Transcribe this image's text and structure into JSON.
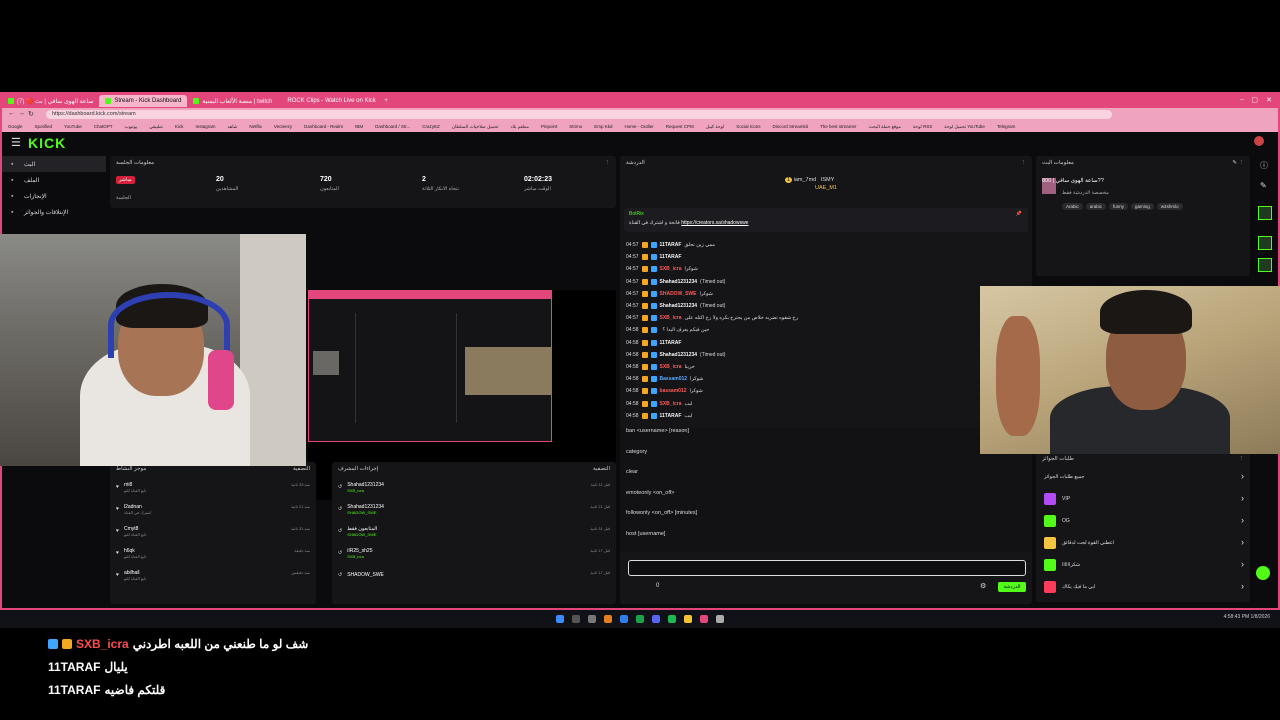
{
  "browser": {
    "tabs": [
      {
        "label": "(7) 🔴 ساعة الهوى ساقي | بث",
        "active": false
      },
      {
        "label": "Stream - Kick Dashboard",
        "active": true
      },
      {
        "label": "منصة الألعاب اليمنية | twitch",
        "active": false
      },
      {
        "label": "ROCK Clips - Watch Live on Kick",
        "active": false
      }
    ],
    "url": "https://dashboard.kick.com/stream",
    "bookmarks": [
      "Google",
      "Spotified",
      "YouTube",
      "ChatGPT",
      "يوتيوب",
      "تطبيقي",
      "Kick",
      "Instagram",
      "شاهد",
      "Netflix",
      "Vecteezy",
      "Dashboard - Realm",
      "IBM",
      "Dashboard / Str...",
      "CrazyEZ",
      "تحميل صلاحيات السلطان",
      "مطعم بلاد",
      "Pinpoint",
      "Strimo",
      "Emp Kkd",
      "Home - Outlier",
      "Request CPM",
      "لوحة كيبل",
      "Social Icons",
      "Discord Streamkit",
      "The best streamer",
      "موقع حملة البحث",
      "لوحة RSS",
      "تحميل لوحة YouTube",
      "Telegram"
    ]
  },
  "kick": {
    "logo": "KICK",
    "sidebar": [
      {
        "label": "البث",
        "active": true
      },
      {
        "label": "الملف",
        "active": false
      },
      {
        "label": "الإنجازات",
        "active": false
      },
      {
        "label": "الإنتلاقات والجوائز",
        "active": false
      }
    ],
    "session": {
      "title": "معلومات الجلسة",
      "live_badge": "مباشر",
      "stats": [
        {
          "value": "",
          "label": "الجلسة"
        },
        {
          "value": "20",
          "label": "المشاهدين"
        },
        {
          "value": "720",
          "label": "المتابعون"
        },
        {
          "value": "2",
          "label": "نتجاه الانكار الثلاثة"
        },
        {
          "value": "02:02:23",
          "label": "الوقت مباشر"
        }
      ]
    },
    "chat": {
      "title": "الدردشة",
      "leaders": [
        {
          "rank": "1",
          "name": "iam_7md",
          "amount": ""
        },
        {
          "rank": "",
          "name": "ISMY",
          "amount": ""
        },
        {
          "rank": "",
          "name": "UAE_M1",
          "amount": ""
        }
      ],
      "pinned_user": "BotRix",
      "pinned_text": "فاتحة و اشترك في القناة",
      "pinned_link": "https://creators.sa/shadowswe",
      "messages": [
        {
          "time": "04:57",
          "user": "11TARAF",
          "color": "#f5f5f5",
          "text": "ممي زين نحلق"
        },
        {
          "time": "04:57",
          "user": "11TARAF",
          "color": "#f5f5f5",
          "text": ""
        },
        {
          "time": "04:57",
          "user": "SXB_icra",
          "color": "#ff5a5a",
          "text": "شوكرا"
        },
        {
          "time": "04:57",
          "user": "Shahad1231234",
          "color": "#f5f5f5",
          "text": "(Timed out)"
        },
        {
          "time": "04:57",
          "user": "SHADOW_SWE",
          "color": "#ff5a5a",
          "text": "شوكرا"
        },
        {
          "time": "04:57",
          "user": "Shahad1231234",
          "color": "#f5f5f5",
          "text": "(Timed out)"
        },
        {
          "time": "04:57",
          "user": "SXB_icra",
          "color": "#ff5a5a",
          "text": "رح شفوه تضربه خلاص من يحترح بكره ولا رح اكتله على"
        },
        {
          "time": "04:58",
          "user": "",
          "color": "#f5f5f5",
          "text": "حين فيكم يعرف اليدا ؟"
        },
        {
          "time": "04:58",
          "user": "11TARAF",
          "color": "#f5f5f5",
          "text": ""
        },
        {
          "time": "04:58",
          "user": "Shahad1231234",
          "color": "#f5f5f5",
          "text": "(Timed out)"
        },
        {
          "time": "04:58",
          "user": "SXB_icra",
          "color": "#ff5a5a",
          "text": "خرينا"
        },
        {
          "time": "04:58",
          "user": "Bassam012",
          "color": "#5aa9ff",
          "text": "شوكرا"
        },
        {
          "time": "04:58",
          "user": "bassam012",
          "color": "#ff5a5a",
          "text": "شوكرا"
        },
        {
          "time": "04:58",
          "user": "SXB_icra",
          "color": "#ff5a5a",
          "text": "لبب"
        },
        {
          "time": "04:58",
          "user": "11TARAF",
          "color": "#f5f5f5",
          "text": "لبب"
        }
      ],
      "commands": [
        {
          "cmd": "ban <username> [reason]",
          "desc": ""
        },
        {
          "cmd": "category",
          "desc": ""
        },
        {
          "cmd": "clear",
          "desc": ""
        },
        {
          "cmd": "emoteonly <on_off>",
          "desc": ""
        },
        {
          "cmd": "followonly <on_off> [minutes]",
          "desc": ""
        },
        {
          "cmd": "host [username]",
          "desc": ""
        }
      ],
      "input_value": "",
      "send_label": "الدردشة",
      "footer_count": "0"
    },
    "stream_info": {
      "title": "معلومات البث",
      "stream_title": "ساعة الهوى ساقي | 800??",
      "category": "مخصصة الدردشة فقط",
      "tags": [
        "Arabic",
        "arabic",
        "funny",
        "gaming",
        "w3shmlo"
      ]
    },
    "activity": {
      "title": "موجز النشاط",
      "tab": "التصفية",
      "items": [
        {
          "name": "rrii8",
          "sub": "تابع القناة للتو",
          "time": "منذ 33 ثانية"
        },
        {
          "name": "l2adnan",
          "sub": "اشترك في القناة",
          "time": "منذ 21 ثانية"
        },
        {
          "name": "Cmyt8",
          "sub": "تابع القناة للتو",
          "time": "منذ 31 ثانية"
        },
        {
          "name": "h6qk",
          "sub": "تابع القناة للتو",
          "time": "منذ دقيقة"
        },
        {
          "name": "abilhall",
          "sub": "تابع القناة للتو",
          "time": "منذ دقيقتين"
        }
      ]
    },
    "modactions": {
      "title": "إجراءات المشرف",
      "tab": "التصفية",
      "items": [
        {
          "name": "Shahad1231234",
          "sub": "SXB_icra",
          "time": "قبل 11 ثانية"
        },
        {
          "name": "Shahad1231234",
          "sub": "SHADOW_SWE",
          "time": "قبل 21 ثانية"
        },
        {
          "name": "المتابعون فقط",
          "sub": "SHADOW_SWE",
          "time": "قبل 31 ثانية"
        },
        {
          "name": "iIR25_sh25",
          "sub": "SXB_icra",
          "time": "قبل 17 ثانية"
        },
        {
          "name": "SHADOW_SWE",
          "sub": "",
          "time": "قبل 17 ثانية"
        }
      ]
    },
    "rewards": {
      "title": "طلبات الجوائز",
      "heading": "جميع طلبات الجوائز",
      "items": [
        {
          "name": "VIP",
          "color": "#b24bf3"
        },
        {
          "name": "OG",
          "color": "#53fc18"
        },
        {
          "name": "اعطني القوة لجت لدقائق",
          "color": "#f5c542"
        },
        {
          "name": "شكراااااا",
          "color": "#53fc18"
        },
        {
          "name": "ابي ما فيك يكاك",
          "color": "#ff3b5c"
        }
      ]
    }
  },
  "taskbar": {
    "clock": "4:58:43 PM",
    "date": "1/8/2026"
  },
  "overlay_chat": [
    {
      "user": "SXB_icra",
      "color": "#ff4d4d",
      "msg": "شف لو ما طنعني من اللعبه اطردني"
    },
    {
      "user": "11TARAF",
      "color": "#ffffff",
      "msg": "يليال"
    },
    {
      "user": "11TARAF",
      "color": "#ffffff",
      "msg": "قلتكم فاضيه"
    }
  ]
}
